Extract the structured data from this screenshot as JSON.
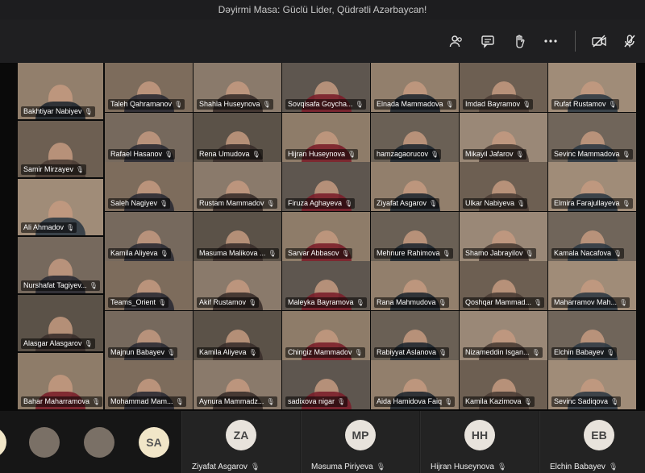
{
  "window": {
    "title": "Dəyirmi Masa: Güclü Lider, Qüdrətli Azərbaycan!"
  },
  "toolbar": {
    "icons": [
      "participants-icon",
      "chat-icon",
      "raise-hand-icon",
      "more-icon",
      "camera-off-icon",
      "mic-off-icon"
    ]
  },
  "left_column": [
    {
      "name": "Bakhtiyar Nabiyev"
    },
    {
      "name": "Samir Mirzayev"
    },
    {
      "name": "Ali Ahmadov"
    },
    {
      "name": "Nurshafat Tagiyev..."
    },
    {
      "name": "Alasgar Alasgarov"
    },
    {
      "name": "Bahar Maharramova"
    }
  ],
  "grid": [
    [
      "Taleh Qahramanov",
      "Shahla Huseynova",
      "Sovqisafa Goycha...",
      "Elnada Mammadova",
      "Imdad Bayramov",
      "Rufat Rustamov"
    ],
    [
      "Rafael Hasanov",
      "Rena Umudova",
      "Hijran Huseynova",
      "hamzagaorucov",
      "Mikayil Jafarov",
      "Sevinc Mammadova"
    ],
    [
      "Saleh Nagiyev",
      "Rustam Mammadov",
      "Firuza Aghayeva",
      "Ziyafat Asgarov",
      "Ulkar Nabiyeva",
      "Elmira Farajullayeva"
    ],
    [
      "Kamila Aliyeva",
      "Masuma Malikova ...",
      "Sarvar Abbasov",
      "Mehnure Rahimova",
      "Shamo Jabrayilov",
      "Kamala Nacafova"
    ],
    [
      "Teams_Orient",
      "Akif Rustamov",
      "Maleyka Bayramova",
      "Rana Mahmudova",
      "Qoshqar Mammad...",
      "Maharramov Mah..."
    ],
    [
      "Majnun Babayev",
      "Kamila Aliyeva",
      "Chingiz Mammadov",
      "Rabiyyat Aslanova",
      "Nizameddin Isgan...",
      "Elchin Babayev"
    ],
    [
      "Mohammad Mam...",
      "Aynura Mammadz...",
      "sadixova nigar",
      "Aida Hamidova Faiq",
      "Kamila Kazimova",
      "Sevinc Sadiqova"
    ]
  ],
  "strip": {
    "left_avatars": [
      {
        "initials": "",
        "type": "photo"
      },
      {
        "initials": "",
        "type": "photo"
      },
      {
        "initials": "SA",
        "type": "initials"
      }
    ],
    "cards": [
      {
        "initials": "ZA",
        "name": "Ziyafat Asgarov"
      },
      {
        "initials": "MP",
        "name": "Məsuma Piriyeva"
      },
      {
        "initials": "HH",
        "name": "Hijran Huseynova"
      },
      {
        "initials": "EB",
        "name": "Elchin Babayev"
      }
    ]
  },
  "colors": {
    "toolbar_bg": "#1f1f21",
    "stage_bg": "#0a0a0a",
    "avatar_bg": "#e8e3dc"
  }
}
